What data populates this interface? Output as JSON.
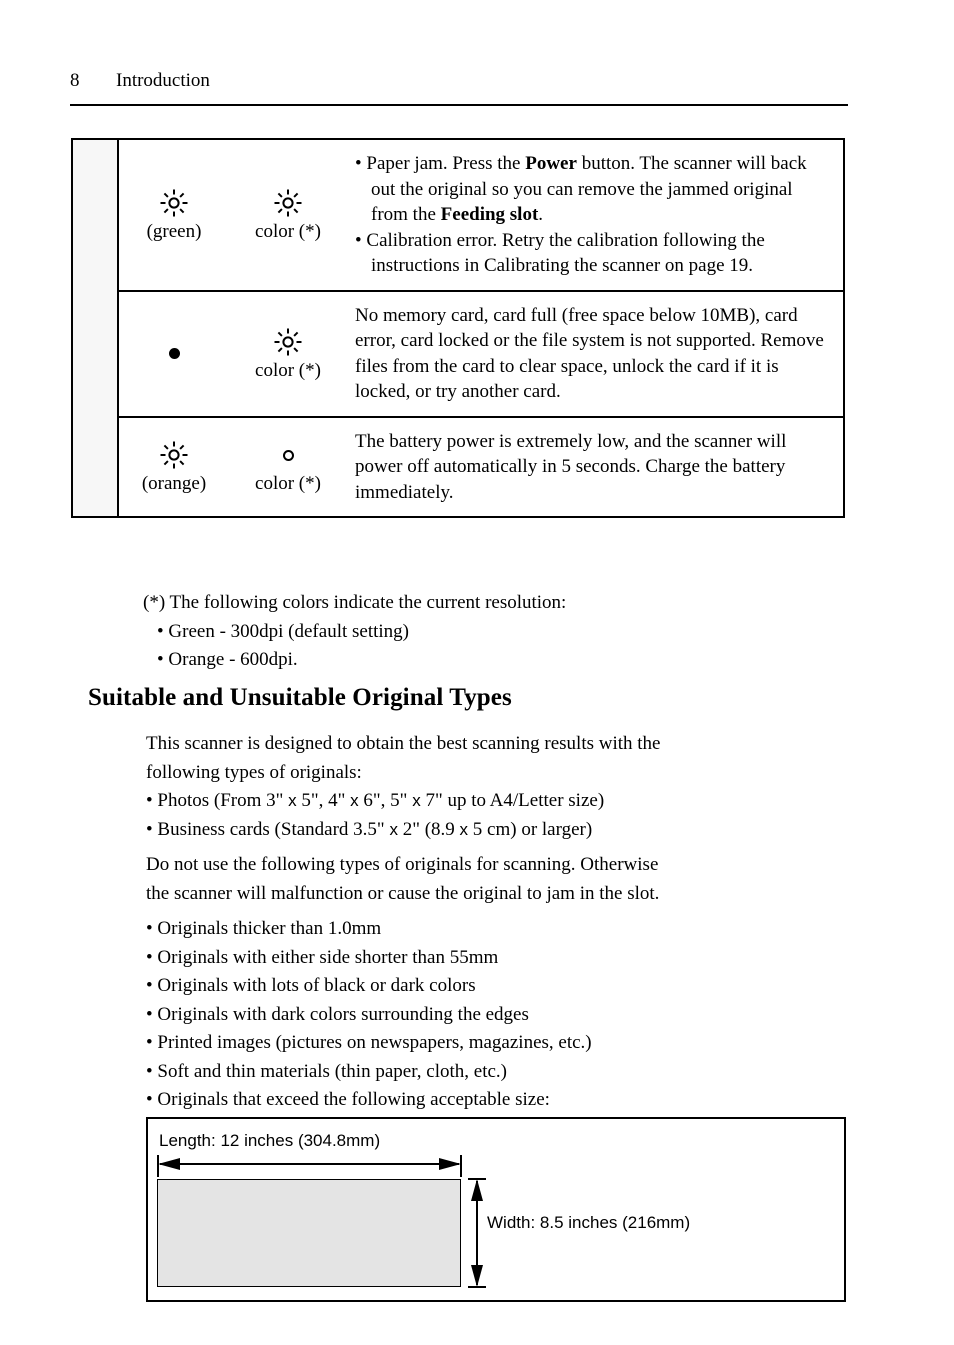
{
  "header": {
    "page_number": "8",
    "section": "Introduction"
  },
  "status_table": {
    "rows": [
      {
        "led_left": {
          "icon": "blinking-led-icon",
          "label": "(green)"
        },
        "led_right": {
          "icon": "blinking-led-icon",
          "label": "color (*)"
        },
        "description_lines": [
          "• Paper jam. Press the Power button. The scanner will back out the original so you can remove the jammed original from the Feeding slot.",
          "• Calibration error. Retry the calibration following the instructions in Calibrating the scanner on page 19."
        ],
        "bullet1": {
          "part1": "• Paper jam. Press the ",
          "bold1": "Power",
          "part2": " button. The scanner will back out the original so you can remove the jammed original from the ",
          "bold2": "Feeding slot",
          "part3": "."
        },
        "bullet2": "• Calibration error. Retry the calibration following the instructions in Calibrating the scanner on page 19."
      },
      {
        "led_left": {
          "icon": "solid-led-icon",
          "label": ""
        },
        "led_right": {
          "icon": "blinking-led-icon",
          "label": "color (*)"
        },
        "description": "No memory card, card full (free space below 10MB), card error, card locked or the file system is not supported. Remove files from the card to clear space, unlock the card if it is locked, or try another card."
      },
      {
        "led_left": {
          "icon": "blinking-led-icon",
          "label": "(orange)"
        },
        "led_right": {
          "icon": "off-led-icon",
          "label": "color (*)"
        },
        "description": "The battery power is extremely low, and the scanner will power off automatically in 5 seconds. Charge the battery immediately."
      }
    ]
  },
  "notes": {
    "intro": "(*) The following colors indicate the current resolution:",
    "items": [
      "• Green - 300dpi (default setting)",
      "• Orange - 600dpi."
    ]
  },
  "section": {
    "heading": "Suitable and Unsuitable Original Types",
    "intro_line1": "This scanner is designed to obtain the best scanning results with the",
    "intro_line2": "following types of originals:",
    "suitable": {
      "photos": {
        "pre": "• Photos (From 3\" ",
        "x1": "x",
        "mid1": " 5\", 4\" ",
        "x2": "x",
        "mid2": " 6\", 5\" ",
        "x3": "x",
        "post": " 7\" up to A4/Letter size)"
      },
      "cards": {
        "pre": "• Business cards (Standard 3.5\" ",
        "x1": "x",
        "mid1": " 2\" (8.9 ",
        "x2": "x",
        "post": " 5 cm) or larger)"
      }
    },
    "warning_line1": "Do not use the following types of originals for scanning. Otherwise",
    "warning_line2": "the scanner will malfunction or cause the original to jam in the slot.",
    "unsuitable": [
      "• Originals thicker than 1.0mm",
      "• Originals with either side shorter than 55mm",
      "• Originals with lots of black or dark colors",
      "• Originals with dark colors surrounding the edges",
      "• Printed images (pictures on newspapers, magazines, etc.)",
      "• Soft and thin materials (thin paper, cloth, etc.)",
      "• Originals that exceed the following acceptable size:"
    ]
  },
  "diagram": {
    "length_label": "Length: 12 inches (304.8mm)",
    "width_label": "Width: 8.5 inches (216mm)",
    "paper_fill": "#e4e4e4"
  }
}
